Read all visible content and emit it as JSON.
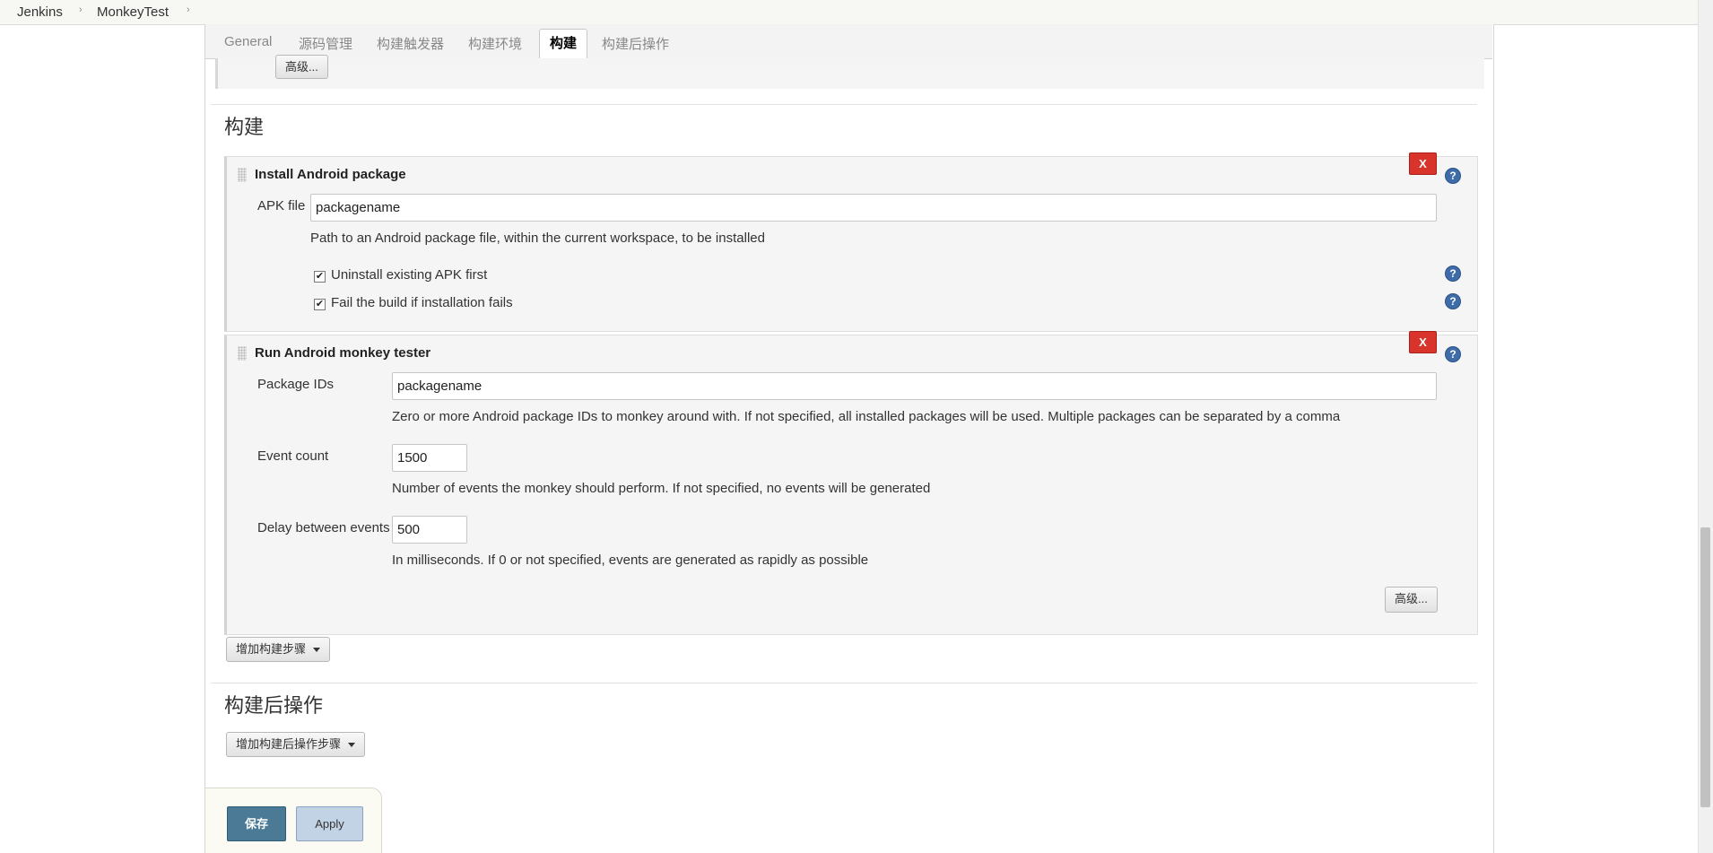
{
  "breadcrumb": {
    "items": [
      "Jenkins",
      "MonkeyTest"
    ],
    "separator": "›"
  },
  "tabs": [
    "General",
    "源码管理",
    "构建触发器",
    "构建环境",
    "构建",
    "构建后操作"
  ],
  "active_tab": "构建",
  "advanced_top_label": "高级...",
  "build_section": {
    "title": "构建",
    "steps": {
      "install": {
        "title": "Install Android package",
        "apk_label": "APK file",
        "apk_value": "packagename",
        "apk_desc": "Path to an Android package file, within the current workspace, to be installed",
        "uninstall_label": "Uninstall existing APK first",
        "uninstall_checked": true,
        "fail_label": "Fail the build if installation fails",
        "fail_checked": true,
        "delete_label": "X"
      },
      "monkey": {
        "title": "Run Android monkey tester",
        "package_label": "Package IDs",
        "package_value": "packagename",
        "package_desc": "Zero or more Android package IDs to monkey around with. If not specified, all installed packages will be used. Multiple packages can be separated by a comma",
        "event_label": "Event count",
        "event_value": "1500",
        "event_desc": "Number of events the monkey should perform. If not specified, no events will be generated",
        "delay_label": "Delay between events",
        "delay_value": "500",
        "delay_desc": "In milliseconds. If 0 or not specified, events are generated as rapidly as possible",
        "advanced_label": "高级...",
        "delete_label": "X"
      }
    },
    "add_step_label": "增加构建步骤"
  },
  "post_build_section": {
    "title": "构建后操作",
    "add_step_label": "增加构建后操作步骤"
  },
  "buttons": {
    "save": "保存",
    "apply": "Apply"
  },
  "help_symbol": "?",
  "checkmark": "✔",
  "colors": {
    "delete_red": "#d9342b",
    "save_blue": "#4a7a95",
    "apply_blue": "#c3d3e6",
    "help_blue": "#3e6ca8"
  }
}
